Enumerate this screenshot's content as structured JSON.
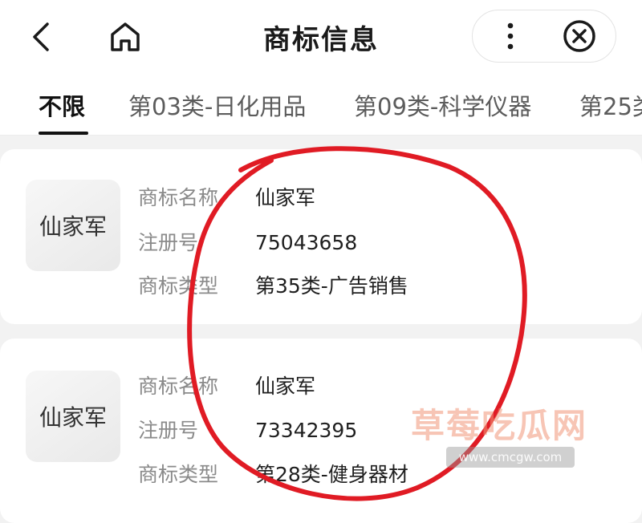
{
  "header": {
    "title": "商标信息",
    "back_icon": "chevron-left",
    "home_icon": "home",
    "more_icon": "vertical-dots",
    "close_icon": "circle-x"
  },
  "tabs": [
    {
      "label": "不限",
      "active": true
    },
    {
      "label": "第03类-日化用品",
      "active": false
    },
    {
      "label": "第09类-科学仪器",
      "active": false
    },
    {
      "label": "第25类",
      "active": false
    }
  ],
  "labels": {
    "name": "商标名称",
    "reg_no": "注册号",
    "type": "商标类型"
  },
  "trademarks": [
    {
      "logo_text": "仙家军",
      "name": "仙家军",
      "reg_no": "75043658",
      "type": "第35类-广告销售"
    },
    {
      "logo_text": "仙家军",
      "name": "仙家军",
      "reg_no": "73342395",
      "type": "第28类-健身器材"
    }
  ],
  "watermark": {
    "text": "草莓吃瓜网",
    "url": "www.cmcgw.com"
  },
  "colors": {
    "annotation_red": "#e01b24",
    "active_tab": "#111111",
    "label_gray": "#8a8a8a"
  }
}
